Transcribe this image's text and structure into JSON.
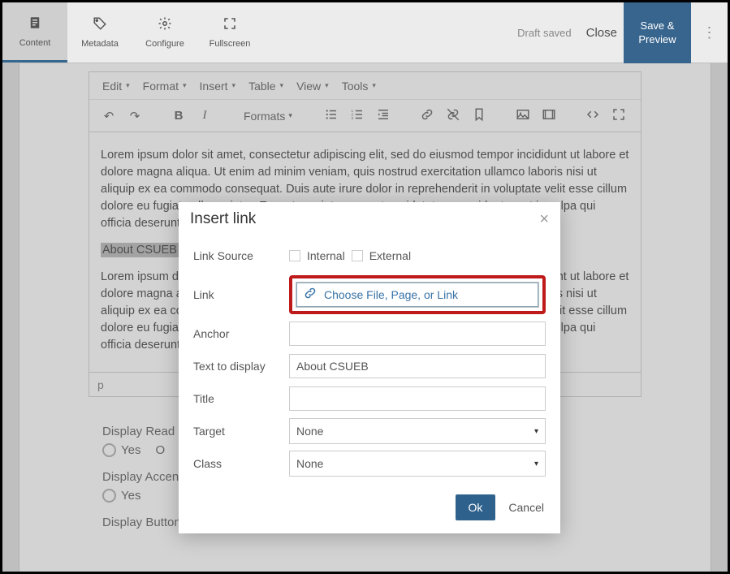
{
  "topbar": {
    "tabs": [
      {
        "label": "Content",
        "icon": "document-icon"
      },
      {
        "label": "Metadata",
        "icon": "tag-icon"
      },
      {
        "label": "Configure",
        "icon": "gear-icon"
      },
      {
        "label": "Fullscreen",
        "icon": "fullscreen-icon"
      }
    ],
    "draft_saved": "Draft saved",
    "close": "Close",
    "savepreview_line1": "Save &",
    "savepreview_line2": "Preview"
  },
  "menubar": {
    "items": [
      "Edit",
      "Format",
      "Insert",
      "Table",
      "View",
      "Tools"
    ]
  },
  "toolbar": {
    "formats_label": "Formats"
  },
  "body": {
    "para1": "Lorem ipsum dolor sit amet, consectetur adipiscing elit, sed do eiusmod tempor incididunt ut labore et dolore magna aliqua. Ut enim ad minim veniam, quis nostrud exercitation ullamco laboris nisi ut aliquip ex ea commodo consequat. Duis aute irure dolor in reprehenderit in voluptate velit esse cillum dolore eu fugiat nulla pariatur. Excepteur sint occaecat cupidatat non proident, sunt in culpa qui officia deserunt mollit anim id est laborum.",
    "selected_text": "About CSUEB",
    "para2": "Lorem ipsum dolor sit amet, consectetur adipiscing elit, sed do eiusmod tempor incididunt ut labore et dolore magna aliqua. Ut enim ad minim veniam, quis nostrud exercitation ullamco laboris nisi ut aliquip ex ea commodo consequat. Duis aute irure dolor in reprehenderit in voluptate velit esse cillum dolore eu fugiat nulla pariatur. Excepteur sint occaecat cupidatat non proident, sunt in culpa qui officia deserunt mollit anim id est laborum.",
    "status_path": "p"
  },
  "below": {
    "readmore": {
      "label": "Display Read More Button?",
      "opt_yes": "Yes",
      "opt_other": "O"
    },
    "accent": {
      "label": "Display Accent?",
      "opt_yes": "Yes"
    },
    "button": {
      "label": "Display Button?"
    }
  },
  "dialog": {
    "title": "Insert link",
    "linksource_label": "Link Source",
    "linksource_opts": {
      "internal": "Internal",
      "external": "External"
    },
    "link_label": "Link",
    "link_choose": "Choose File, Page, or Link",
    "anchor_label": "Anchor",
    "anchor_value": "",
    "text_label": "Text to display",
    "text_value": "About CSUEB",
    "title_label": "Title",
    "title_value": "",
    "target_label": "Target",
    "target_value": "None",
    "class_label": "Class",
    "class_value": "None",
    "ok": "Ok",
    "cancel": "Cancel"
  }
}
